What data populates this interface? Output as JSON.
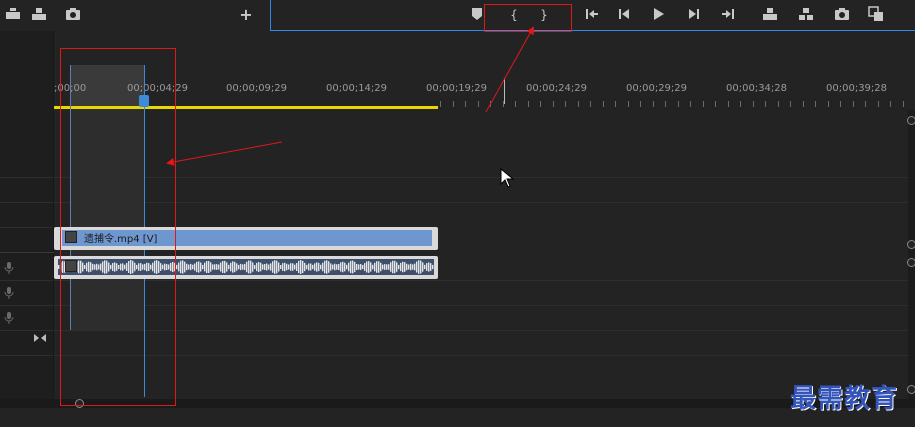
{
  "toolbar_left": {
    "icons": [
      "lift-icon",
      "export-frame-icon",
      "camera-icon",
      "add-button-icon"
    ],
    "add_label": "+"
  },
  "monitor_toolbar": {
    "mark_in_label": "{",
    "mark_out_label": "}",
    "icons": [
      "marker-icon",
      "mark-in-icon",
      "mark-out-icon",
      "go-to-in-icon",
      "step-back-icon",
      "play-icon",
      "step-forward-icon",
      "go-to-out-icon",
      "lift-icon",
      "extract-icon",
      "export-frame-icon",
      "compare-icon"
    ]
  },
  "ruler": {
    "labels": [
      ";00;00",
      "00;00;04;29",
      "00;00;09;29",
      "00;00;14;29",
      "00;00;19;29",
      "00;00;24;29",
      "00;00;29;29",
      "00;00;34;28",
      "00;00;39;28"
    ]
  },
  "clips": {
    "video_label": "遗捕令.mp4 [V]"
  },
  "watermark": "最需教育",
  "colors": {
    "accent": "#2d8ceb",
    "work_area": "#e8d800",
    "annotation": "#e01818",
    "video_clip": "#6f97cf"
  }
}
